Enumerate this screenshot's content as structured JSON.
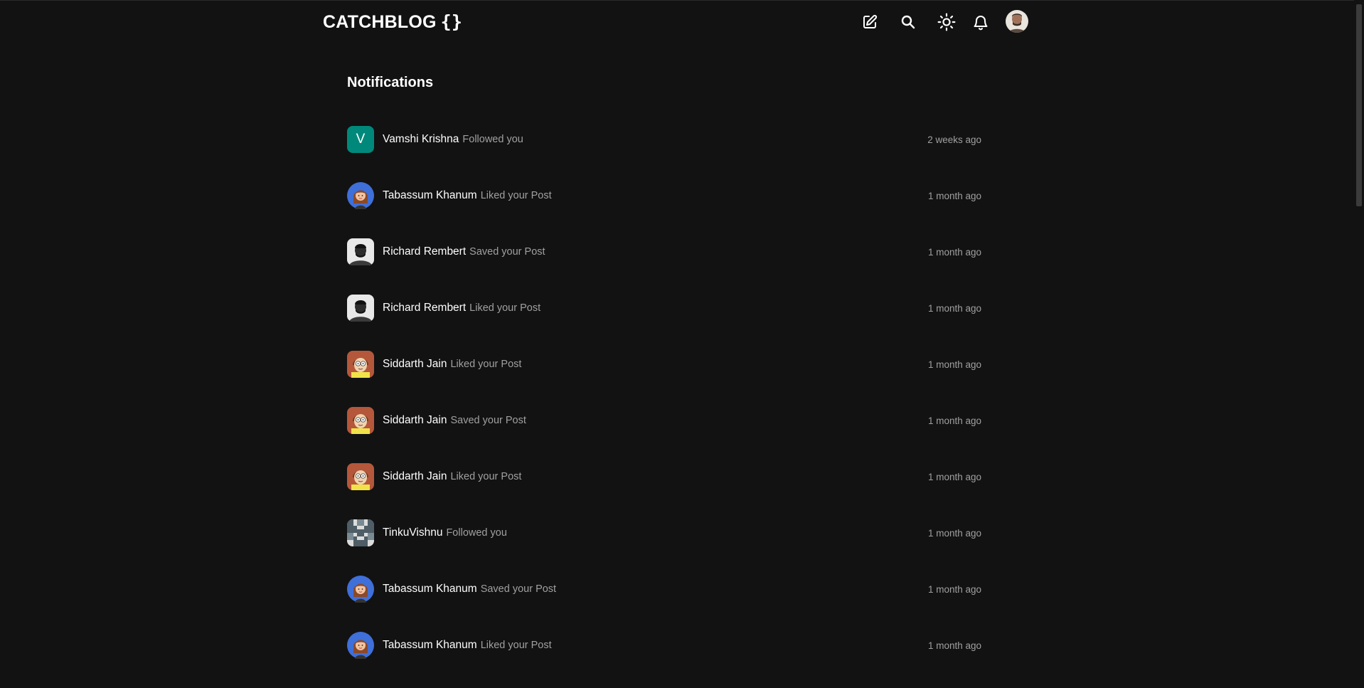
{
  "header": {
    "logo_text": "CATCHBLOG",
    "logo_braces": "{}",
    "icons": [
      "edit-icon",
      "search-icon",
      "sun-icon",
      "bell-icon",
      "user-avatar"
    ]
  },
  "page": {
    "title": "Notifications"
  },
  "colors": {
    "background": "#121212",
    "text": "#ffffff",
    "muted": "#a0a0a0",
    "avatar_v_bg": "#00897b"
  },
  "notifications": [
    {
      "name": "Vamshi Krishna",
      "action": "Followed you",
      "time": "2 weeks ago",
      "avatar": "letter-v",
      "avatar_letter": "V"
    },
    {
      "name": "Tabassum Khanum",
      "action": "Liked your Post",
      "time": "1 month ago",
      "avatar": "girl-cartoon"
    },
    {
      "name": "Richard Rembert",
      "action": "Saved your Post",
      "time": "1 month ago",
      "avatar": "man-photo"
    },
    {
      "name": "Richard Rembert",
      "action": "Liked your Post",
      "time": "1 month ago",
      "avatar": "man-photo"
    },
    {
      "name": "Siddarth Jain",
      "action": "Liked your Post",
      "time": "1 month ago",
      "avatar": "cartoon-boy"
    },
    {
      "name": "Siddarth Jain",
      "action": "Saved your Post",
      "time": "1 month ago",
      "avatar": "cartoon-boy"
    },
    {
      "name": "Siddarth Jain",
      "action": "Liked your Post",
      "time": "1 month ago",
      "avatar": "cartoon-boy"
    },
    {
      "name": "TinkuVishnu",
      "action": "Followed you",
      "time": "1 month ago",
      "avatar": "identicon"
    },
    {
      "name": "Tabassum Khanum",
      "action": "Saved your Post",
      "time": "1 month ago",
      "avatar": "girl-cartoon"
    },
    {
      "name": "Tabassum Khanum",
      "action": "Liked your Post",
      "time": "1 month ago",
      "avatar": "girl-cartoon"
    }
  ]
}
